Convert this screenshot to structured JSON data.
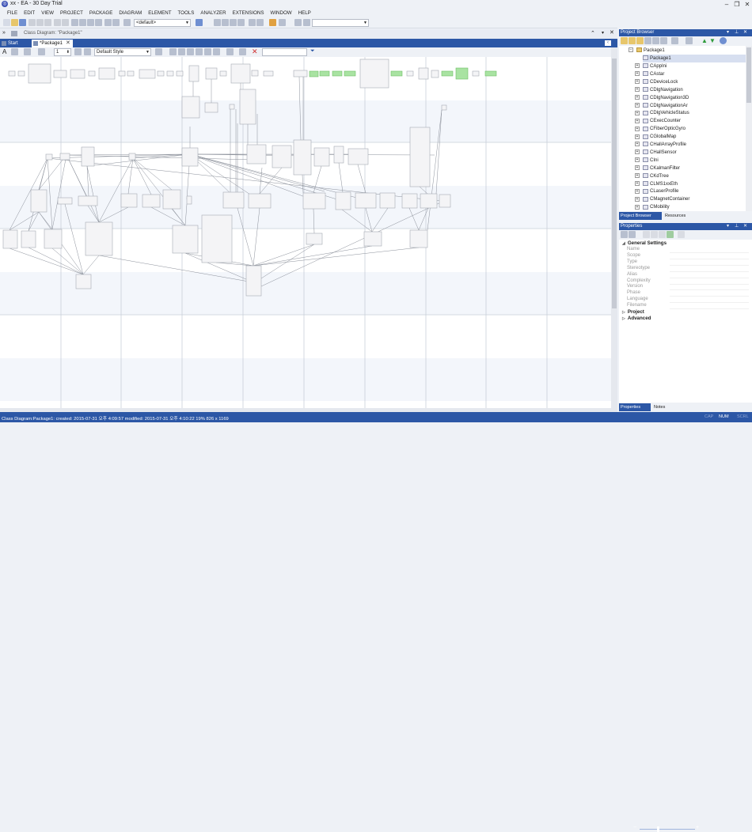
{
  "window": {
    "title": "xx - EA - 30 Day Trial",
    "minimize": "–",
    "restore": "❐",
    "close": "✕"
  },
  "menu": [
    "FILE",
    "EDIT",
    "VIEW",
    "PROJECT",
    "PACKAGE",
    "DIAGRAM",
    "ELEMENT",
    "TOOLS",
    "ANALYZER",
    "EXTENSIONS",
    "WINDOW",
    "HELP"
  ],
  "toolbar": {
    "perspective_combo": "<default>",
    "search_value": ""
  },
  "document": {
    "title": "Class Diagram: \"Package1\"",
    "tabs": [
      {
        "label": "Start Page"
      },
      {
        "label": "*Package1"
      }
    ],
    "tab_close": "✕",
    "style_combo": "Default Style",
    "zoom_spinner": "1",
    "filter_value": ""
  },
  "project_browser": {
    "title": "Project Browser",
    "root": "Package1",
    "diagram": "Package1",
    "classes": [
      "CAppIni",
      "CAstar",
      "CDeviceLock",
      "CDlgNavigation",
      "CDlgNavigation3D",
      "CDlgNavigationAr",
      "CDlgVehicleStatus",
      "CExecCounter",
      "CFiberOpticGyro",
      "CGlobalMap",
      "CHallArrayProfile",
      "CHallSensor",
      "CIni",
      "CKalmanFilter",
      "CKdTree",
      "CLMS1xxEth",
      "CLaserProfile",
      "CMagnetContainer",
      "CMobility"
    ],
    "tabs": [
      "Project Browser",
      "Resources"
    ]
  },
  "properties": {
    "title": "Properties",
    "sections": [
      {
        "name": "General Settings",
        "rows": [
          "Name",
          "Scope",
          "Type",
          "Stereotype",
          "Alias",
          "Complexity",
          "Version",
          "Phase",
          "Language",
          "Filename"
        ]
      },
      {
        "name": "Project",
        "rows": []
      },
      {
        "name": "Advanced",
        "rows": []
      }
    ],
    "tabs": [
      "Properties",
      "Notes"
    ]
  },
  "status": {
    "text": "Class Diagram:Package1:  created: 2015-07-31 오후 4:09:57  modified: 2015-07-31 오후 4:10:22  19%  826 x 1169",
    "cap": "CAP",
    "num": "NUM",
    "scrl": "SCRL",
    "zoom_minus": "−",
    "zoom_plus": "+"
  },
  "colors": {
    "accent": "#2c57a6",
    "note_green": "#a9e3a2"
  }
}
